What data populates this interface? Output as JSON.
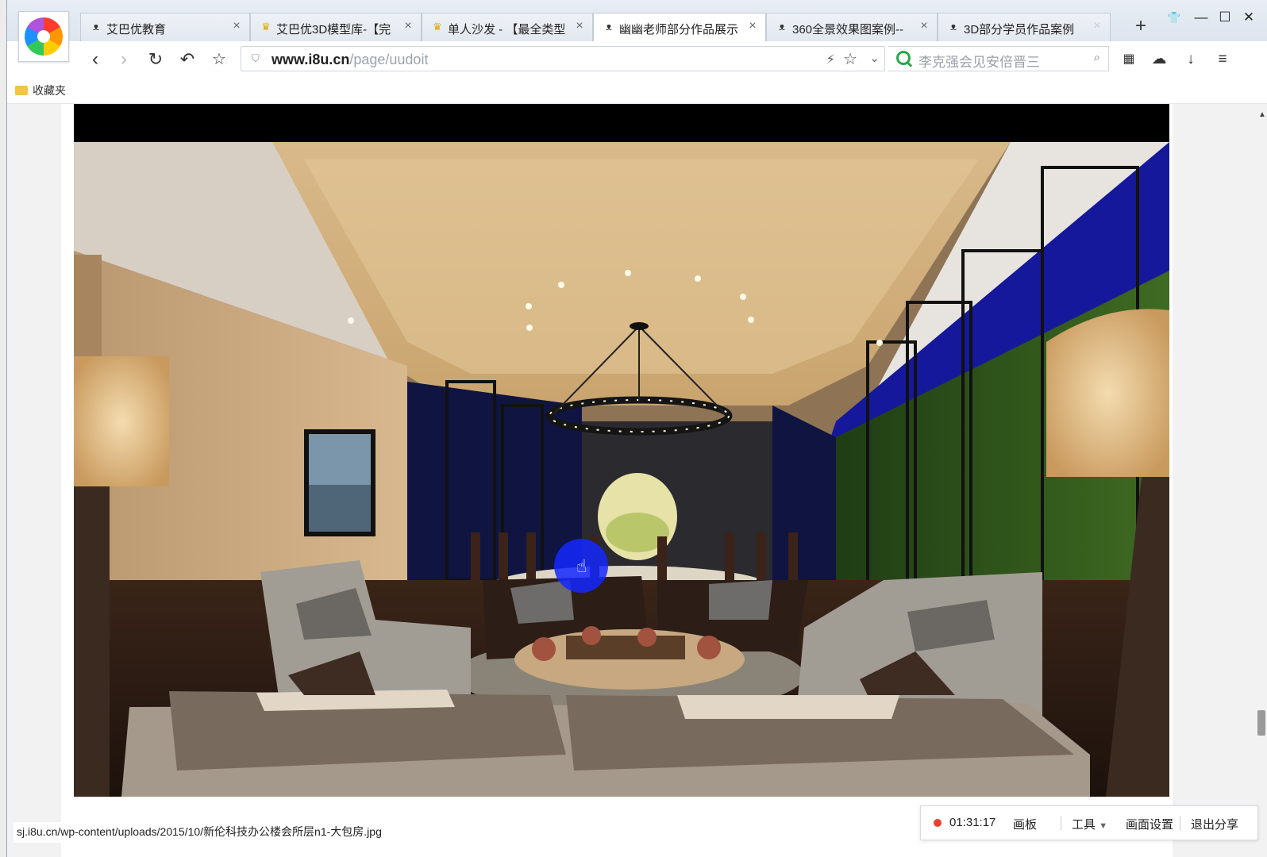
{
  "browser": {
    "tabs": [
      {
        "label": "艾巴优教育",
        "icon": "mask-icon"
      },
      {
        "label": "艾巴优3D模型库-【完",
        "icon": "trophy-icon"
      },
      {
        "label": "单人沙发 - 【最全类型",
        "icon": "trophy-icon"
      },
      {
        "label": "幽幽老师部分作品展示",
        "icon": "mask-icon",
        "active": true
      },
      {
        "label": "360全景效果图案例--",
        "icon": "mask-icon"
      },
      {
        "label": "3D部分学员作品案例",
        "icon": "mask-icon"
      }
    ],
    "address": {
      "domain": "www.i8u.cn",
      "path": "/page/uudoit"
    },
    "search_placeholder": "李克强会见安倍晋三",
    "bookmarks_label": "收藏夹"
  },
  "status_url": "sj.i8u.cn/wp-content/uploads/2015/10/新伦科技办公楼会所层n1-大包房.jpg",
  "share_toolbar": {
    "time": "01:31:17",
    "canvas": "画板",
    "tools": "工具",
    "screen_settings": "画面设置",
    "exit_share": "退出分享"
  },
  "colors": {
    "record_dot": "#e8412f",
    "cursor_highlight": "#1428ff",
    "search_brand": "#2aa84a"
  }
}
